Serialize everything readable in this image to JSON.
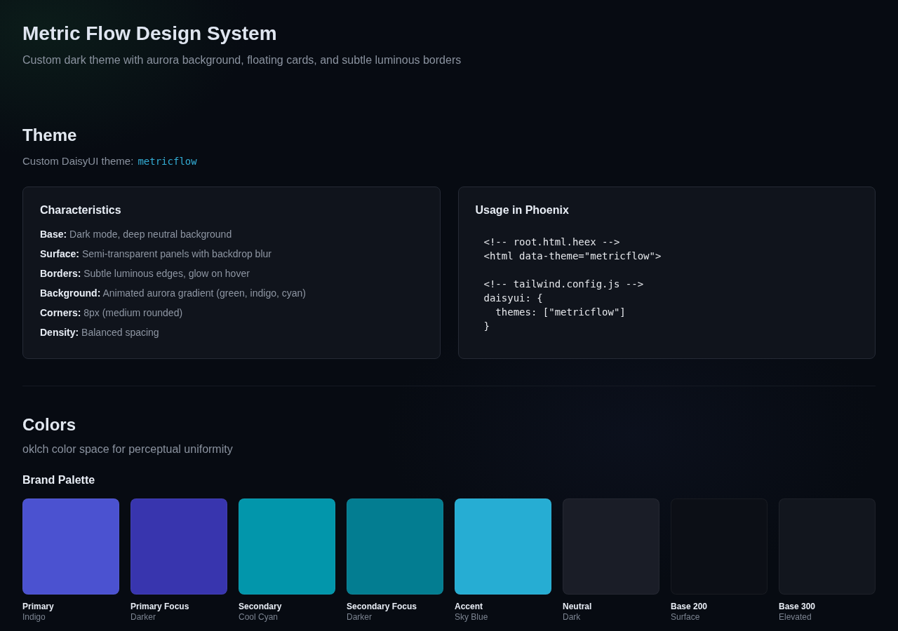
{
  "header": {
    "title": "Metric Flow Design System",
    "subtitle": "Custom dark theme with aurora background, floating cards, and subtle luminous borders"
  },
  "theme": {
    "title": "Theme",
    "description": "Custom DaisyUI theme:",
    "theme_name": "metricflow",
    "characteristics": {
      "title": "Characteristics",
      "items": [
        "**Base:** Dark mode, deep neutral background",
        "**Surface:** Semi-transparent panels with backdrop blur",
        "**Borders:** Subtle luminous edges, glow on hover",
        "**Background:** Animated aurora gradient (green, indigo, cyan)",
        "**Corners:** 8px (medium rounded)",
        "**Density:** Balanced spacing"
      ]
    },
    "usage": {
      "title": "Usage in Phoenix",
      "code": "<!-- root.html.heex -->\n<html data-theme=\"metricflow\">\n\n<!-- tailwind.config.js -->\ndaisyui: {\n  themes: [\"metricflow\"]\n}"
    }
  },
  "colors": {
    "title": "Colors",
    "description": "oklch color space for perceptual uniformity",
    "palette": {
      "title": "Brand Palette",
      "swatches": [
        {
          "name": "Primary",
          "note": "Indigo",
          "color": "#4b52d0"
        },
        {
          "name": "Primary Focus",
          "note": "Darker",
          "color": "#3835ae"
        },
        {
          "name": "Secondary",
          "note": "Cool Cyan",
          "color": "#0296ab"
        },
        {
          "name": "Secondary Focus",
          "note": "Darker",
          "color": "#037d91"
        },
        {
          "name": "Accent",
          "note": "Sky Blue",
          "color": "#26add3"
        },
        {
          "name": "Neutral",
          "note": "Dark",
          "color": "#1a1d27"
        },
        {
          "name": "Base 200",
          "note": "Surface",
          "color": "#0c0f16"
        },
        {
          "name": "Base 300",
          "note": "Elevated",
          "color": "#12161e"
        }
      ]
    }
  }
}
